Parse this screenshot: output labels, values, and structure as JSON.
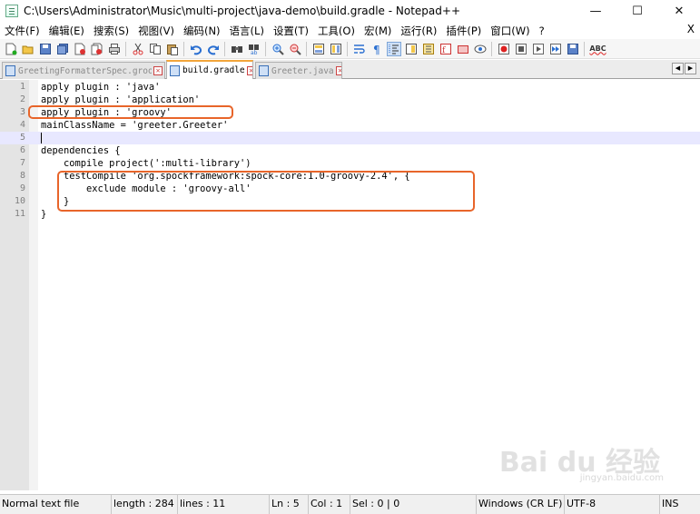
{
  "window": {
    "title": "C:\\Users\\Administrator\\Music\\multi-project\\java-demo\\build.gradle - Notepad++",
    "minimize": "—",
    "maximize": "☐",
    "close": "✕"
  },
  "menu": {
    "items": [
      "文件(F)",
      "编辑(E)",
      "搜索(S)",
      "视图(V)",
      "编码(N)",
      "语言(L)",
      "设置(T)",
      "工具(O)",
      "宏(M)",
      "运行(R)",
      "插件(P)",
      "窗口(W)",
      "?"
    ],
    "close": "X"
  },
  "toolbar": {
    "icons": [
      "new-file-icon",
      "open-file-icon",
      "save-icon",
      "save-all-icon",
      "close-icon",
      "close-all-icon",
      "print-icon",
      "cut-icon",
      "copy-icon",
      "paste-icon",
      "undo-icon",
      "redo-icon",
      "find-icon",
      "replace-icon",
      "zoom-in-icon",
      "zoom-out-icon",
      "sync-vertical-icon",
      "sync-horizontal-icon",
      "word-wrap-icon",
      "show-all-chars-icon",
      "indent-guide-icon",
      "doc-map-icon",
      "function-list-icon",
      "folder-workspace-icon",
      "monitor-icon",
      "record-macro-icon",
      "stop-macro-icon",
      "play-macro-icon",
      "run-macro-multiple-icon",
      "save-macro-icon",
      "spellcheck-icon"
    ],
    "spellcheck_label": "ABC"
  },
  "tabs": [
    {
      "label": "GreetingFormatterSpec.groovy",
      "active": false
    },
    {
      "label": "build.gradle",
      "active": true
    },
    {
      "label": "Greeter.java",
      "active": false
    }
  ],
  "tab_nav": {
    "prev": "◀",
    "next": "▶"
  },
  "editor": {
    "lines": [
      {
        "num": "1",
        "text": "apply plugin : 'java'"
      },
      {
        "num": "2",
        "text": "apply plugin : 'application'"
      },
      {
        "num": "3",
        "text": "apply plugin : 'groovy'"
      },
      {
        "num": "4",
        "text": "mainClassName = 'greeter.Greeter'"
      },
      {
        "num": "5",
        "text": ""
      },
      {
        "num": "6",
        "text": "dependencies {"
      },
      {
        "num": "7",
        "text": "    compile project(':multi-library')"
      },
      {
        "num": "8",
        "text": "    testCompile 'org.spockframework:spock-core:1.0-groovy-2.4', {"
      },
      {
        "num": "9",
        "text": "        exclude module : 'groovy-all'"
      },
      {
        "num": "10",
        "text": "    }"
      },
      {
        "num": "11",
        "text": "}"
      }
    ],
    "current_line": 5
  },
  "watermark": {
    "main": "Bai du 经验",
    "sub": "jingyan.baidu.com"
  },
  "status": {
    "file_type": "Normal text file",
    "length": "length : 284",
    "lines": "lines : 11",
    "ln": "Ln : 5",
    "col": "Col : 1",
    "sel": "Sel : 0 | 0",
    "eol": "Windows (CR LF)",
    "encoding": "UTF-8",
    "mode": "INS"
  },
  "colors": {
    "annotation": "#e8652a",
    "active_tab_accent": "#f2a53a",
    "current_line": "#e8e8ff"
  }
}
